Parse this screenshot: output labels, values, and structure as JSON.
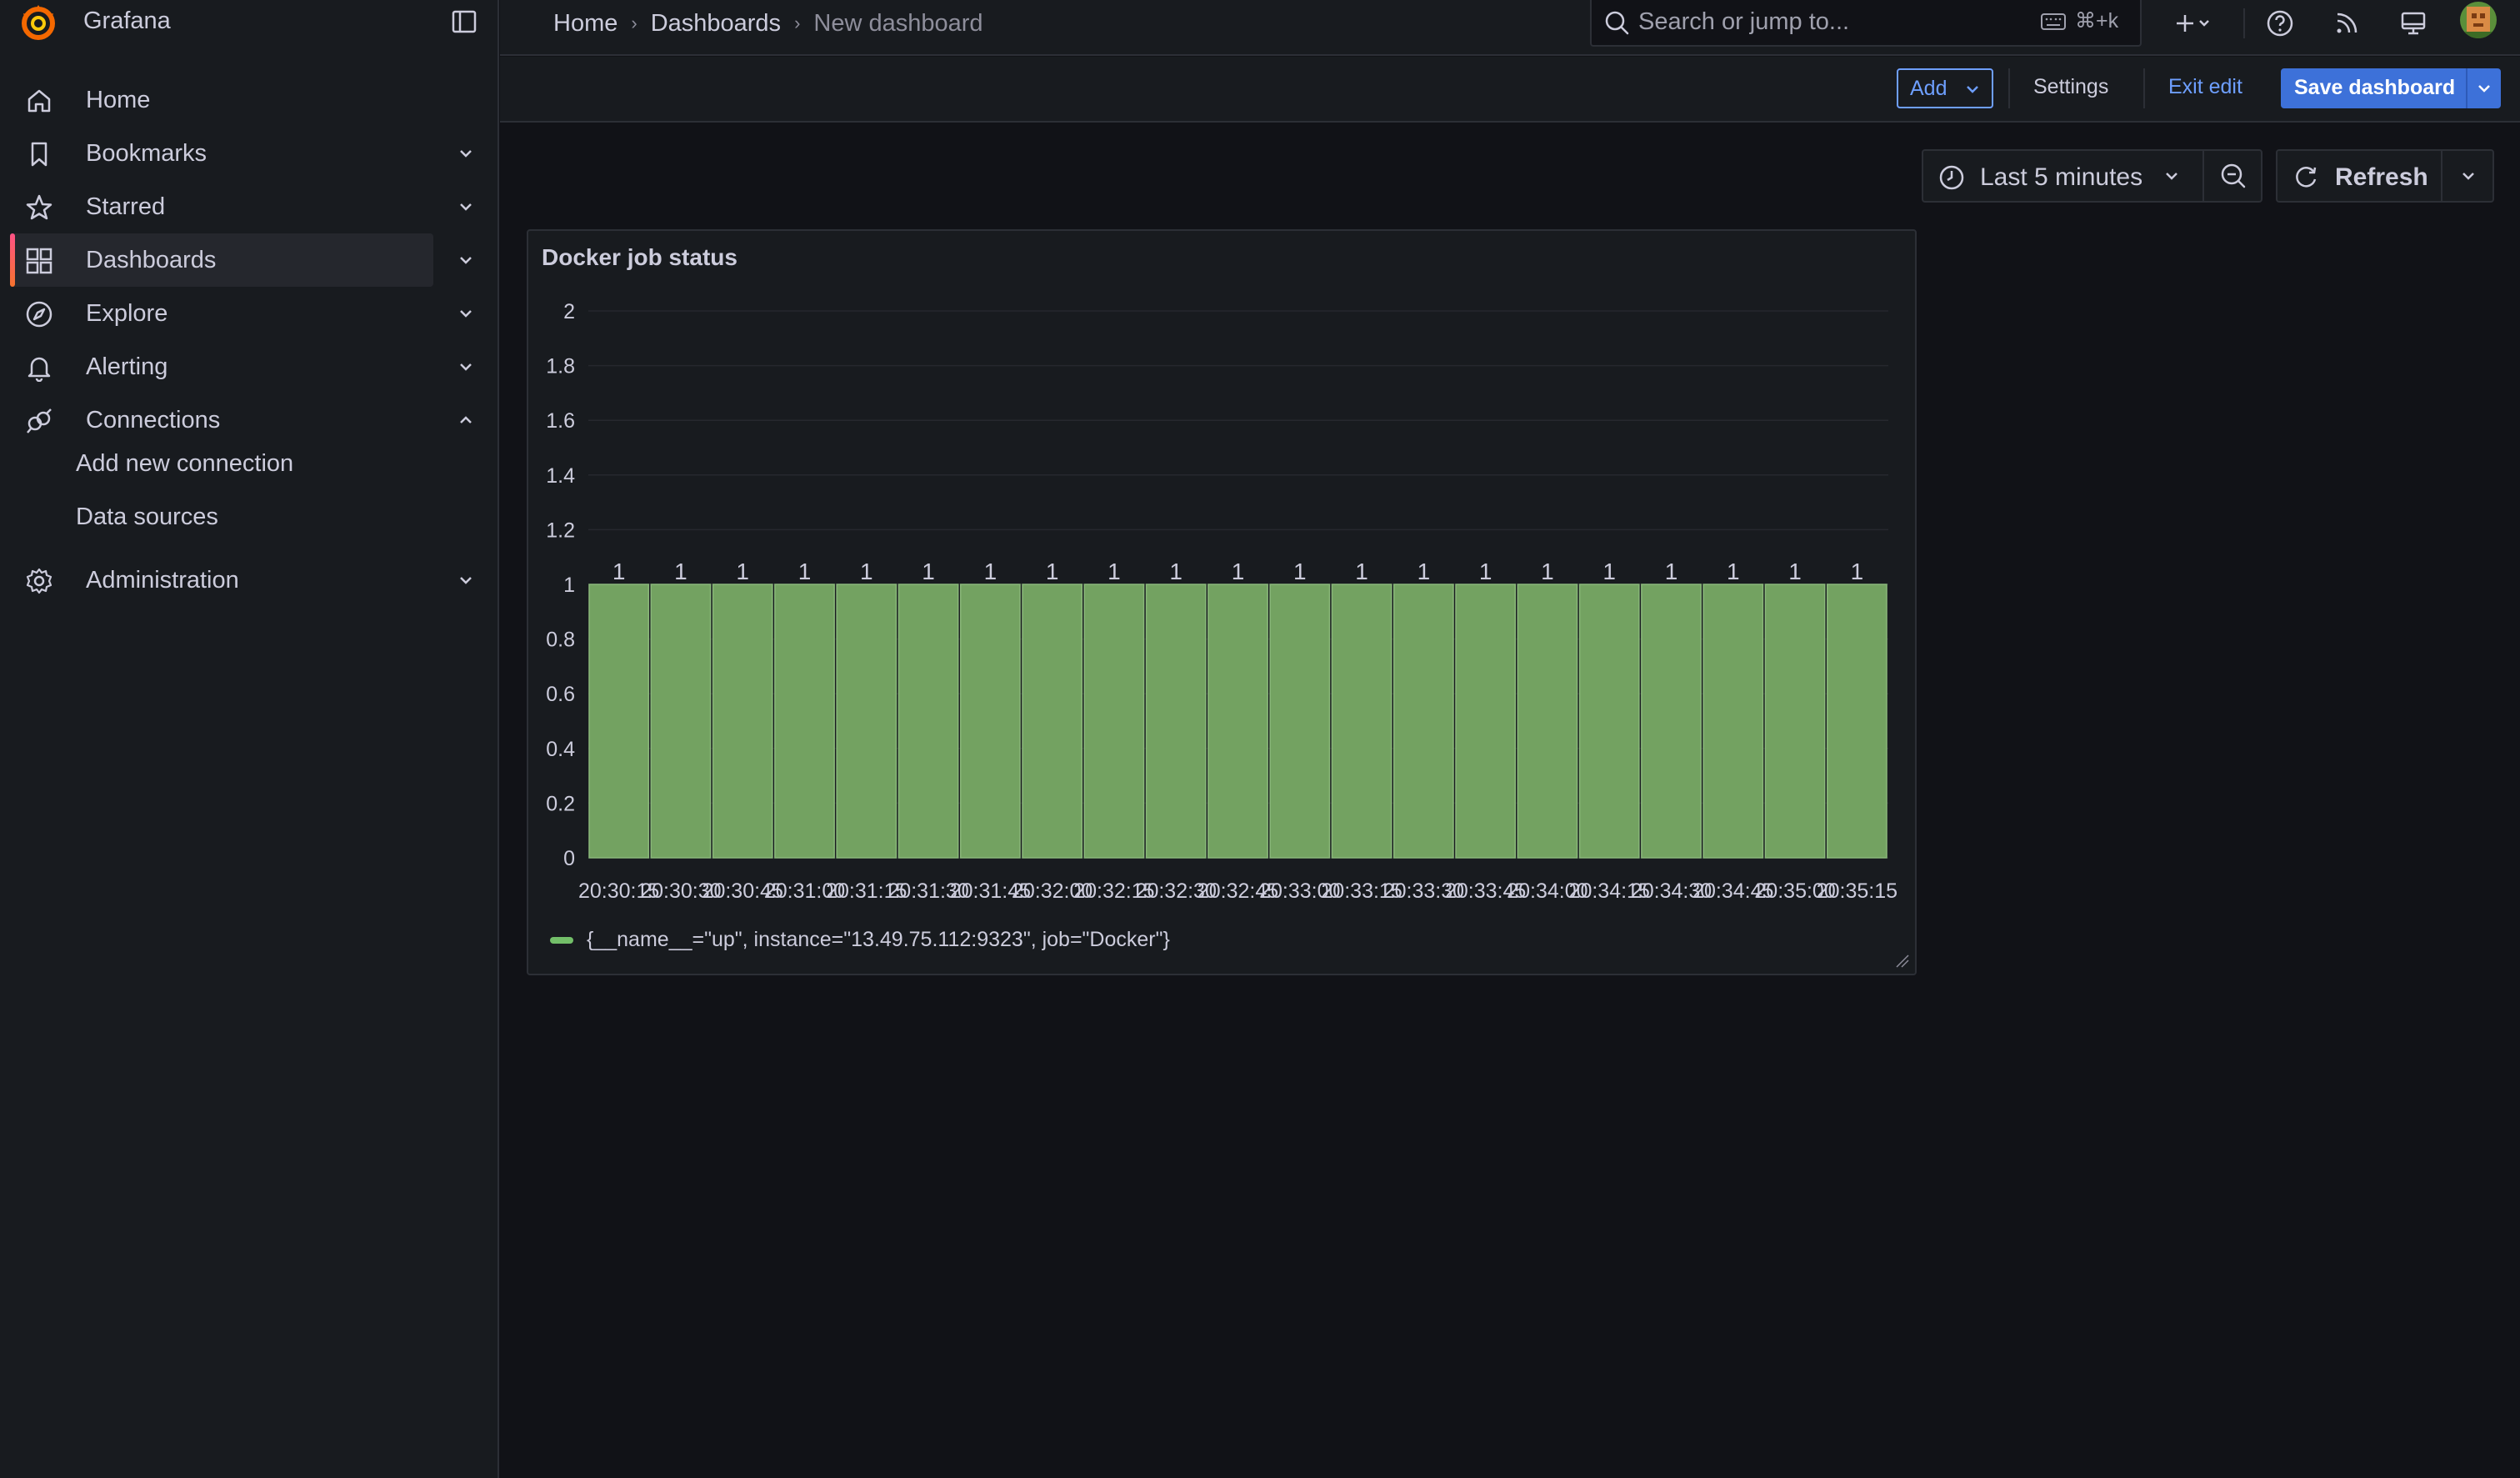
{
  "app": {
    "name": "Grafana"
  },
  "sidebar": {
    "items": [
      {
        "label": "Home",
        "icon": "home-icon",
        "chevron": ""
      },
      {
        "label": "Bookmarks",
        "icon": "bookmark-icon",
        "chevron": "down"
      },
      {
        "label": "Starred",
        "icon": "star-icon",
        "chevron": "down"
      },
      {
        "label": "Dashboards",
        "icon": "dashboards-icon",
        "chevron": "down",
        "active": true
      },
      {
        "label": "Explore",
        "icon": "compass-icon",
        "chevron": "down"
      },
      {
        "label": "Alerting",
        "icon": "bell-icon",
        "chevron": "down"
      },
      {
        "label": "Connections",
        "icon": "connections-icon",
        "chevron": "up"
      },
      {
        "label": "Administration",
        "icon": "gear-icon",
        "chevron": "down"
      }
    ],
    "subitems": [
      {
        "label": "Add new connection"
      },
      {
        "label": "Data sources"
      }
    ]
  },
  "topbar": {
    "breadcrumb": [
      "Home",
      "Dashboards",
      "New dashboard"
    ],
    "search_placeholder": "Search or jump to...",
    "shortcut": "⌘+k"
  },
  "toolbar": {
    "add_label": "Add",
    "settings_label": "Settings",
    "exit_label": "Exit edit",
    "save_label": "Save dashboard"
  },
  "time": {
    "range_label": "Last 5 minutes",
    "refresh_label": "Refresh"
  },
  "panel": {
    "title": "Docker job status"
  },
  "colors": {
    "accent_blue": "#3d71d9",
    "link_blue": "#6e9fff",
    "bar_fill": "#73a261",
    "bar_stroke": "#8ab87a",
    "legend_green": "#73bf69"
  },
  "chart_data": {
    "type": "bar",
    "title": "Docker job status",
    "categories": [
      "20:30:15",
      "20:30:30",
      "20:30:45",
      "20:31:00",
      "20:31:15",
      "20:31:30",
      "20:31:45",
      "20:32:00",
      "20:32:15",
      "20:32:30",
      "20:32:45",
      "20:33:00",
      "20:33:15",
      "20:33:30",
      "20:33:45",
      "20:34:00",
      "20:34:15",
      "20:34:30",
      "20:34:45",
      "20:35:00",
      "20:35:15"
    ],
    "series": [
      {
        "name": "{__name__=\"up\", instance=\"13.49.75.112:9323\", job=\"Docker\"}",
        "values": [
          1,
          1,
          1,
          1,
          1,
          1,
          1,
          1,
          1,
          1,
          1,
          1,
          1,
          1,
          1,
          1,
          1,
          1,
          1,
          1,
          1
        ]
      }
    ],
    "yticks": [
      "0",
      "0.2",
      "0.4",
      "0.6",
      "0.8",
      "1",
      "1.2",
      "1.4",
      "1.6",
      "1.8",
      "2"
    ],
    "ylim": [
      0,
      2
    ],
    "xlabel": "",
    "ylabel": "",
    "grid": true,
    "legend_position": "bottom-left",
    "show_value_labels": true
  }
}
